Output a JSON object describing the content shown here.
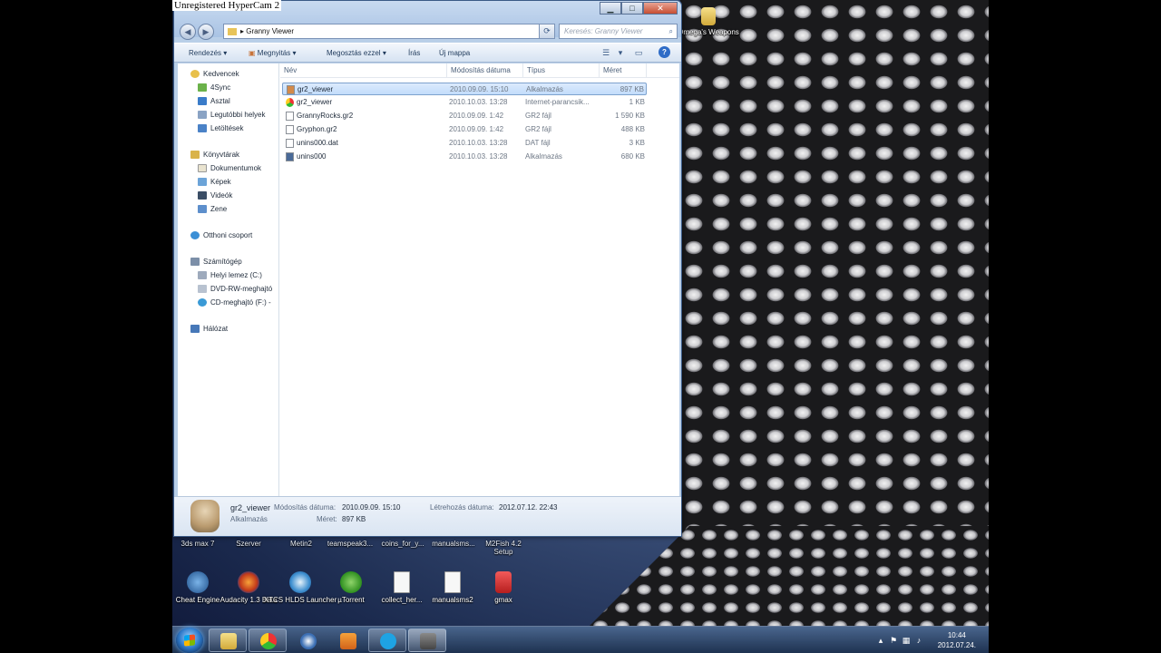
{
  "overlay": {
    "recorder_text": "Unregistered HyperCam 2"
  },
  "window": {
    "address": "Granny Viewer",
    "search_placeholder": "Keresés: Granny Viewer",
    "toolbar": {
      "organize": "Rendezés",
      "open": "Megnyitás",
      "share": "Megosztás ezzel",
      "burn": "Írás",
      "new_folder": "Új mappa"
    }
  },
  "nav": {
    "favorites": "Kedvencek",
    "fav_items": [
      "4Sync",
      "Asztal",
      "Legutóbbi helyek",
      "Letöltések"
    ],
    "libraries": "Könyvtárak",
    "lib_items": [
      "Dokumentumok",
      "Képek",
      "Videók",
      "Zene"
    ],
    "homegroup": "Otthoni csoport",
    "computer": "Számítógép",
    "comp_items": [
      "Helyi lemez (C:)",
      "DVD-RW-meghajtó",
      "CD-meghajtó (F:) -"
    ],
    "network": "Hálózat"
  },
  "columns": {
    "name": "Név",
    "date": "Módosítás dátuma",
    "type": "Típus",
    "size": "Méret"
  },
  "files": [
    {
      "name": "gr2_viewer",
      "date": "2010.09.09. 15:10",
      "type": "Alkalmazás",
      "size": "897 KB",
      "icon_color": "#c8743a"
    },
    {
      "name": "gr2_viewer",
      "date": "2010.10.03. 13:28",
      "type": "Internet-parancsik...",
      "size": "1 KB",
      "icon_color": "#2a8bd6"
    },
    {
      "name": "GrannyRocks.gr2",
      "date": "2010.09.09. 1:42",
      "type": "GR2 fájl",
      "size": "1 590 KB",
      "icon_color": "#ffffff"
    },
    {
      "name": "Gryphon.gr2",
      "date": "2010.09.09. 1:42",
      "type": "GR2 fájl",
      "size": "488 KB",
      "icon_color": "#ffffff"
    },
    {
      "name": "unins000.dat",
      "date": "2010.10.03. 13:28",
      "type": "DAT fájl",
      "size": "3 KB",
      "icon_color": "#ffffff"
    },
    {
      "name": "unins000",
      "date": "2010.10.03. 13:28",
      "type": "Alkalmazás",
      "size": "680 KB",
      "icon_color": "#4a6a98"
    }
  ],
  "details": {
    "name": "gr2_viewer",
    "kind": "Alkalmazás",
    "modified_label": "Módosítás dátuma:",
    "modified_value": "2010.09.09. 15:10",
    "created_label": "Létrehozás dátuma:",
    "created_value": "2012.07.12. 22:43",
    "size_label": "Méret:",
    "size_value": "897 KB"
  },
  "desktop": {
    "top_right_icon": "Omega's Weapons",
    "row1": [
      "3ds max 7",
      "Szerver",
      "Metin2",
      "teamspeak3...",
      "coins_for_y...",
      "manualsms...",
      "M2Fish 4.2 Setup"
    ],
    "row2": [
      "Cheat Engine",
      "Audacity 1.3 Beta",
      "XTCS HLDS Launcher",
      "µTorrent",
      "collect_her...",
      "manualsms2",
      "gmax"
    ]
  },
  "taskbar": {
    "clock_time": "10:44",
    "clock_date": "2012.07.24."
  }
}
